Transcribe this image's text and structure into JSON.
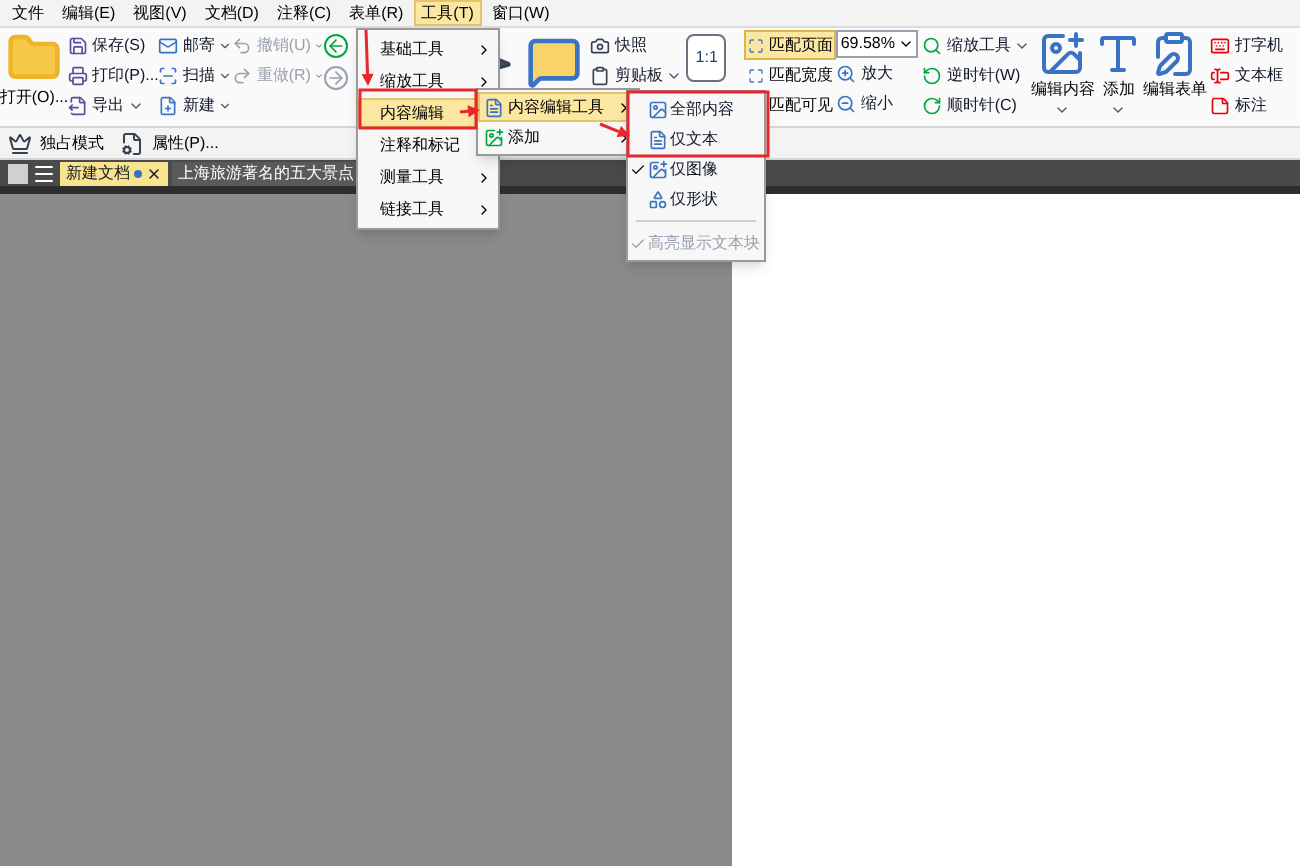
{
  "menu_bar": [
    {
      "label": "文件",
      "selected": false
    },
    {
      "label": "编辑(E)",
      "selected": false
    },
    {
      "label": "视图(V)",
      "selected": false
    },
    {
      "label": "文档(D)",
      "selected": false
    },
    {
      "label": "注释(C)",
      "selected": false
    },
    {
      "label": "表单(R)",
      "selected": false
    },
    {
      "label": "工具(T)",
      "selected": true
    },
    {
      "label": "窗口(W)",
      "selected": false
    }
  ],
  "ribbon": {
    "open_button": "打开(O)...",
    "file_column": [
      {
        "label": "保存(S)",
        "dropdown": false,
        "disabled": false
      },
      {
        "label": "打印(P)...",
        "dropdown": false,
        "disabled": false
      },
      {
        "label": "导出",
        "dropdown": true,
        "disabled": false
      }
    ],
    "send_column": [
      {
        "label": "邮寄",
        "dropdown": true,
        "disabled": false
      },
      {
        "label": "扫描",
        "dropdown": true,
        "disabled": false
      },
      {
        "label": "新建",
        "dropdown": true,
        "disabled": false
      }
    ],
    "history_column": [
      {
        "label": "撤销(U)",
        "dropdown": true,
        "disabled": true
      },
      {
        "label": "重做(R)",
        "dropdown": true,
        "disabled": true
      }
    ],
    "clip_column": [
      {
        "label": "快照",
        "dropdown": false,
        "disabled": false
      },
      {
        "label": "剪贴板",
        "dropdown": true,
        "disabled": false
      }
    ],
    "actual_size": "1:1",
    "fit_column": [
      {
        "label": "匹配页面",
        "selected": true
      },
      {
        "label": "匹配宽度",
        "selected": false
      },
      {
        "label": "匹配可见",
        "selected": false
      }
    ],
    "zoom_field": {
      "value": "69.58%"
    },
    "zoom_column": [
      {
        "label": "放大"
      },
      {
        "label": "缩小"
      }
    ],
    "rotate_column": [
      {
        "label": "缩放工具",
        "dropdown": true
      },
      {
        "label": "逆时针(W)",
        "dropdown": false
      },
      {
        "label": "顺时针(C)",
        "dropdown": false
      }
    ],
    "large_buttons": [
      {
        "label": "编辑内容",
        "dropdown": true
      },
      {
        "label": "添加",
        "dropdown": true
      },
      {
        "label": "编辑表单",
        "dropdown": false
      }
    ],
    "annotate_column": [
      {
        "label": "打字机"
      },
      {
        "label": "文本框"
      },
      {
        "label": "标注"
      }
    ]
  },
  "toolbar": [
    {
      "label": "独占模式"
    },
    {
      "label": "属性(P)..."
    }
  ],
  "tabs": [
    {
      "label": "新建文档",
      "modified": true,
      "selected": true
    },
    {
      "label": "上海旅游著名的五大景点",
      "modified": false,
      "selected": false
    }
  ],
  "tools_menu": [
    {
      "label": "基础工具",
      "highlighted": false
    },
    {
      "label": "缩放工具",
      "highlighted": false
    },
    {
      "label": "内容编辑",
      "highlighted": true
    },
    {
      "label": "注释和标记",
      "highlighted": false
    },
    {
      "label": "测量工具",
      "highlighted": false
    },
    {
      "label": "链接工具",
      "highlighted": false
    }
  ],
  "content_edit_menu": [
    {
      "label": "内容编辑工具",
      "highlighted": true
    },
    {
      "label": "添加",
      "highlighted": false
    }
  ],
  "content_tools_menu": [
    {
      "label": "全部内容",
      "kind": "option",
      "checked": false,
      "disabled": false
    },
    {
      "label": "仅文本",
      "kind": "option",
      "checked": false,
      "disabled": false
    },
    {
      "label": "仅图像",
      "kind": "option",
      "checked": true,
      "disabled": false
    },
    {
      "label": "仅形状",
      "kind": "option",
      "checked": false,
      "disabled": false
    },
    {
      "label": "高亮显示文本块",
      "kind": "toggle",
      "checked": true,
      "disabled": true
    }
  ]
}
